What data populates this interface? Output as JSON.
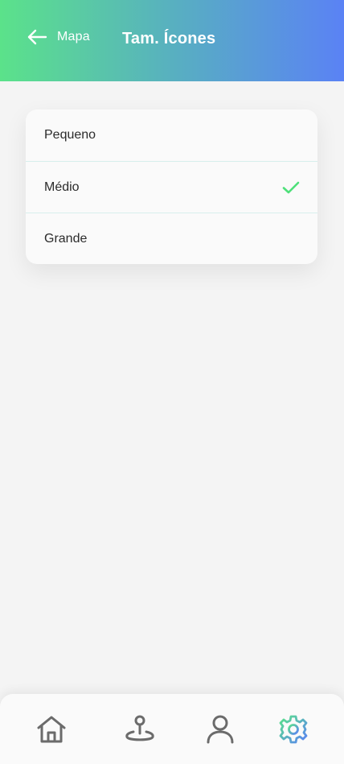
{
  "header": {
    "back_label": "Mapa",
    "title": "Tam. Ícones",
    "back_icon": "arrow-left-icon",
    "gradient": [
      "#5be28a",
      "#58b0c0",
      "#5a82f5"
    ]
  },
  "options": [
    {
      "label": "Pequeno",
      "selected": false
    },
    {
      "label": "Médio",
      "selected": true
    },
    {
      "label": "Grande",
      "selected": false
    }
  ],
  "check_color": "#4ee07a",
  "tabbar": {
    "items": [
      {
        "name": "home",
        "icon": "home-icon",
        "active": false
      },
      {
        "name": "location",
        "icon": "location-pin-icon",
        "active": false
      },
      {
        "name": "profile",
        "icon": "user-icon",
        "active": false
      },
      {
        "name": "settings",
        "icon": "gear-icon",
        "active": true
      }
    ],
    "inactive_color": "#6b6b6b"
  }
}
